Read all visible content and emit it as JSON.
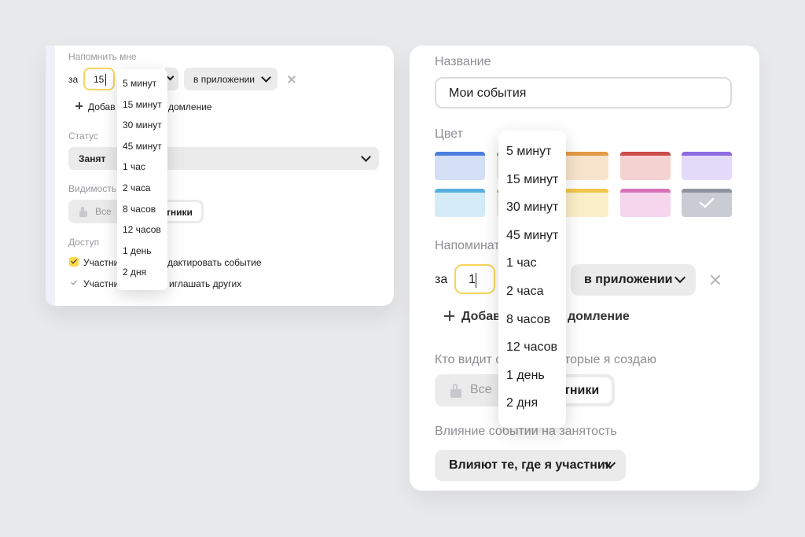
{
  "left_panel": {
    "remind_label": "Напомнить мне",
    "for_label": "за",
    "minutes_value": "15",
    "channel_select": "в приложении",
    "add_reminder_partial_left": "Добав",
    "add_reminder_partial_right": "домление",
    "status_label": "Статус",
    "status_value": "Занят",
    "visibility_label": "Видимость",
    "visibility_all": "Все",
    "visibility_participants_partial": "тники",
    "access_label": "Доступ",
    "access_items": [
      {
        "left": "Участни",
        "right": "дактировать событие",
        "checked": true
      },
      {
        "left": "Участни",
        "right": "иглашать других",
        "checked": false
      }
    ],
    "dropdown_options": [
      "5 минут",
      "15 минут",
      "30 минут",
      "45 минут",
      "1 час",
      "2 часа",
      "8 часов",
      "12 часов",
      "1 день",
      "2 дня"
    ]
  },
  "right_panel": {
    "name_label": "Название",
    "name_value": "Мои события",
    "color_label": "Цвет",
    "swatches_row1": [
      {
        "top": "#4c7fdd",
        "bg": "#d3e0f6"
      },
      {
        "top": "#6fbe62",
        "bg": "#dff0d9"
      },
      {
        "top": "#e39a44",
        "bg": "#f8e4cc"
      },
      {
        "top": "#cc4b4b",
        "bg": "#f5d2d2"
      },
      {
        "top": "#8d6be0",
        "bg": "#e4dafa"
      }
    ],
    "swatches_row2": [
      {
        "top": "#58aede",
        "bg": "#d5ecf8"
      },
      {
        "top": "#9bcf5c",
        "bg": "#e6f3d6"
      },
      {
        "top": "#f0c64b",
        "bg": "#fbefc9"
      },
      {
        "top": "#d873b7",
        "bg": "#f6d6ec"
      },
      {
        "top": "#8e939e",
        "bg": "#c9ccd3"
      }
    ],
    "reminders_label_partial": "Напоминат",
    "for_label": "за",
    "minutes_value": "1",
    "channel_select": "в приложении",
    "add_reminder_partial_left": "Добав",
    "add_reminder_partial_right": "домление",
    "who_sees_partial_left": "Кто видит с",
    "who_sees_partial_right": "торые я создаю",
    "visibility_all": "Все",
    "visibility_participants_partial": "тники",
    "busy_label": "Влияние событий на занятость",
    "busy_value": "Влияют те, где я участник",
    "dropdown_options": [
      "5 минут",
      "15 минут",
      "30 минут",
      "45 минут",
      "1 час",
      "2 часа",
      "8 часов",
      "12 часов",
      "1 день",
      "2 дня"
    ]
  }
}
